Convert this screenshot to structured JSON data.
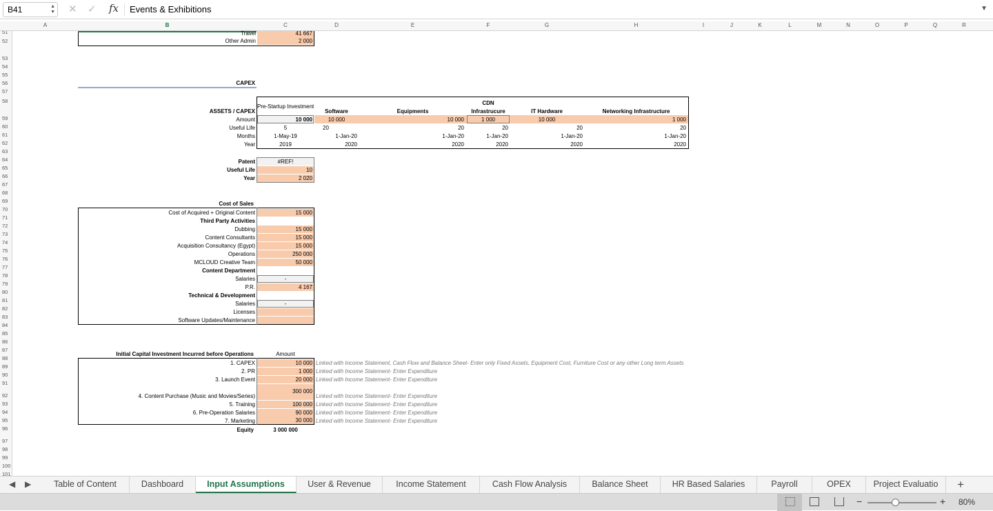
{
  "formula_bar": {
    "name_box": "B41",
    "fx": "fx",
    "value": "Events & Exhibitions"
  },
  "columns": [
    "A",
    "B",
    "C",
    "D",
    "E",
    "F",
    "G",
    "H",
    "I",
    "J",
    "K",
    "L",
    "M",
    "N",
    "O",
    "P",
    "Q",
    "R"
  ],
  "rows": [
    "51",
    "52",
    "53",
    "54",
    "55",
    "56",
    "57",
    "58",
    "59",
    "60",
    "61",
    "62",
    "63",
    "64",
    "65",
    "66",
    "67",
    "68",
    "69",
    "70",
    "71",
    "72",
    "73",
    "74",
    "75",
    "76",
    "77",
    "78",
    "79",
    "80",
    "81",
    "82",
    "83",
    "84",
    "85",
    "86",
    "87",
    "88",
    "89",
    "90",
    "91",
    "92",
    "93",
    "94",
    "95",
    "96",
    "97",
    "98",
    "99",
    "100",
    "101"
  ],
  "top_section": {
    "travel_label": "Travel",
    "travel_value": "41 667",
    "admin_label": "Other Admin",
    "admin_value": "2 000"
  },
  "capex": {
    "title": "CAPEX",
    "header_label": "ASSETS / CAPEX",
    "pre_startup": "Pre-Startup Investment",
    "col_software": "Software",
    "col_equipments": "Equipments",
    "col_cdn_1": "CDN",
    "col_cdn_2": "Infrastrucure",
    "col_it": "IT Hardware",
    "col_network": "Networking Infrastructure",
    "row_amount": "Amount",
    "row_life": "Useful Life",
    "row_months": "Months",
    "row_year": "Year",
    "pre_amount": "10 000",
    "pre_life": "5",
    "pre_months": "1-May-19",
    "pre_year": "2019",
    "soft_amount": "10 000",
    "soft_life": "20",
    "soft_months": "1-Jan-20",
    "soft_year": "2020",
    "eq_amount": "10 000",
    "eq_life": "20",
    "eq_months": "1-Jan-20",
    "eq_year": "2020",
    "cdn_amount": "1 000",
    "cdn_life": "20",
    "cdn_months": "1-Jan-20",
    "cdn_year": "2020",
    "it_amount": "10 000",
    "it_life": "20",
    "it_months": "1-Jan-20",
    "it_year": "2020",
    "net_amount": "1 000",
    "net_life": "20",
    "net_months": "1-Jan-20",
    "net_year": "2020"
  },
  "patent": {
    "label": "Patent",
    "value": "#REF!",
    "life_label": "Useful Life",
    "life_value": "10",
    "year_label": "Year",
    "year_value": "2 020"
  },
  "cost_of_sales": {
    "title": "Cost of Sales",
    "acq_label": "Cost of Acquired + Original Content",
    "acq_value": "15 000",
    "third_party": "Third Party Activities",
    "dubbing": "Dubbing",
    "dubbing_value": "15 000",
    "consultants": "Content Consultants",
    "consultants_value": "15 000",
    "acq_consult": "Acquisition Consultancy (Egypt)",
    "acq_consult_value": "15 000",
    "operations": "Operations",
    "operations_value": "250 000",
    "mcloud": "MCLOUD Creative Team",
    "mcloud_value": "50 000",
    "content_dept": "Content Department",
    "salaries": "Salaries",
    "salaries_value": "-",
    "pr": "P.R.",
    "pr_value": "4 167",
    "tech_dev": "Technical & Development",
    "tech_salaries": "Salaries",
    "tech_salaries_value": "-",
    "licenses": "Licenses",
    "software_updates": "Software Updates/Maintenance"
  },
  "initial_capital": {
    "title": "Initial Capital Investment Incurred before Operations",
    "amount_header": "Amount",
    "items": [
      {
        "label": "1. CAPEX",
        "value": "10 000",
        "note": "Linked with Income Statement, Cash Flow and Balance Sheet- Enter only Fixed Assets, Equipment Cost, Furniture Cost or any other Long term Assets"
      },
      {
        "label": "2. PR",
        "value": "1 000",
        "note": "Linked with Income Statement- Enter Expenditure"
      },
      {
        "label": "3. Launch Event",
        "value": "20 000",
        "note": "Linked with Income Statement- Enter Expenditure"
      },
      {
        "label": "4. Content Purchase (Music and Movies/Series)",
        "value": "300 000",
        "note": "Linked with Income Statement- Enter Expenditure"
      },
      {
        "label": "5. Training",
        "value": "100 000",
        "note": "Linked with Income Statement- Enter Expenditure"
      },
      {
        "label": "6. Pre-Operation Salaries",
        "value": "90 000",
        "note": "Linked with Income Statement- Enter Expenditure"
      },
      {
        "label": "7. Marketing",
        "value": "30 000",
        "note": "Linked with Income Statement- Enter Expenditure"
      }
    ],
    "equity_label": "Equity",
    "equity_value": "3 000 000"
  },
  "tabs": [
    "Table of Content",
    "Dashboard",
    "Input Assumptions",
    "User & Revenue",
    "Income Statement",
    "Cash Flow Analysis",
    "Balance Sheet",
    "HR Based Salaries",
    "Payroll",
    "OPEX",
    "Project Evaluatio"
  ],
  "active_tab": "Input Assumptions",
  "zoom": "80%"
}
